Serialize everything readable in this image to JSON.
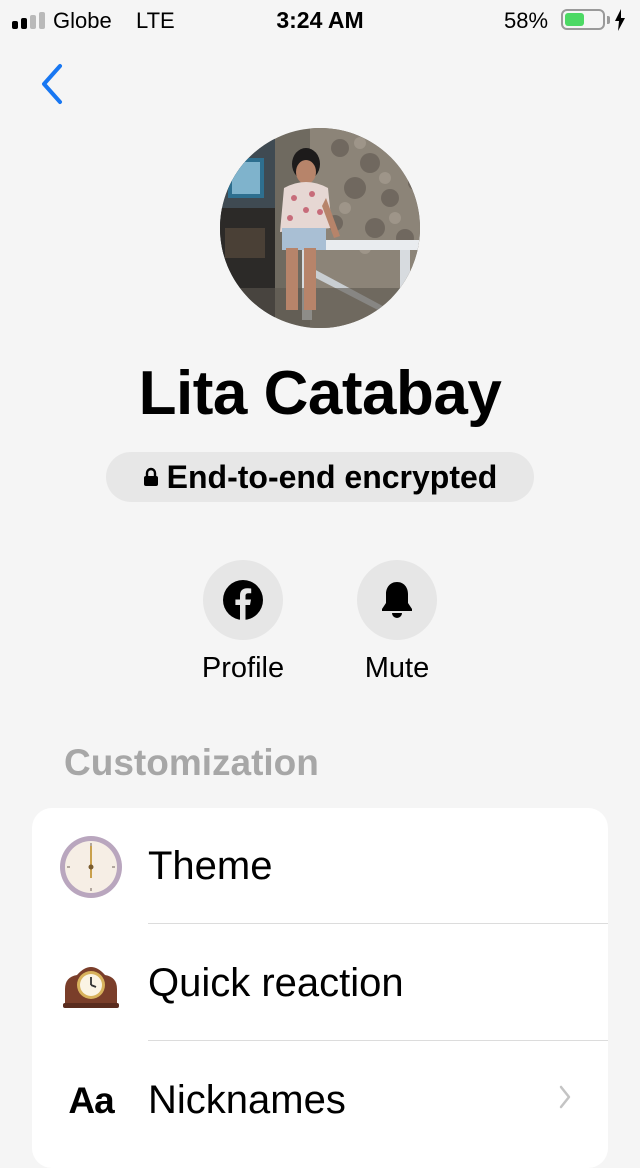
{
  "status_bar": {
    "carrier": "Globe",
    "network": "LTE",
    "time": "3:24 AM",
    "battery_percent": "58%",
    "battery_level": 0.58,
    "signal_bars": 4,
    "signal_bars_filled": 2
  },
  "header": {
    "back_icon": "chevron-left-icon"
  },
  "profile": {
    "name": "Lita Catabay",
    "encryption_label": "End-to-end encrypted",
    "encryption_icon": "lock-icon"
  },
  "actions": [
    {
      "label": "Profile",
      "icon": "facebook-icon"
    },
    {
      "label": "Mute",
      "icon": "bell-icon"
    }
  ],
  "customization": {
    "header": "Customization",
    "items": [
      {
        "label": "Theme",
        "icon": "clock-face-icon"
      },
      {
        "label": "Quick reaction",
        "icon": "mantelpiece-clock-icon"
      },
      {
        "label": "Nicknames",
        "icon_text": "Aa",
        "icon": "aa-text-icon"
      }
    ]
  },
  "colors": {
    "accent": "#1877f2",
    "battery": "#4cd964",
    "section_header": "#a7a7a7"
  }
}
